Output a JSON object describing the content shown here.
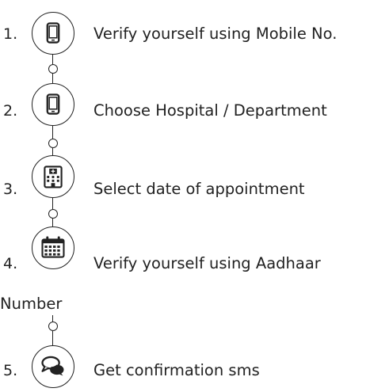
{
  "steps": [
    {
      "number": "1.",
      "label": "Verify yourself using Mobile No.",
      "icon": "mobile-phone-icon"
    },
    {
      "number": "2.",
      "label": "Choose Hospital / Department",
      "icon": "mobile-phone-icon"
    },
    {
      "number": "3.",
      "label": "Select date of appointment",
      "icon": "hospital-building-icon"
    },
    {
      "number": "4.",
      "label": "Verify yourself using Aadhaar",
      "label_continued": "Number",
      "icon": "calendar-icon"
    },
    {
      "number": "5.",
      "label": "Get confirmation sms",
      "icon": "chat-bubbles-icon"
    }
  ]
}
